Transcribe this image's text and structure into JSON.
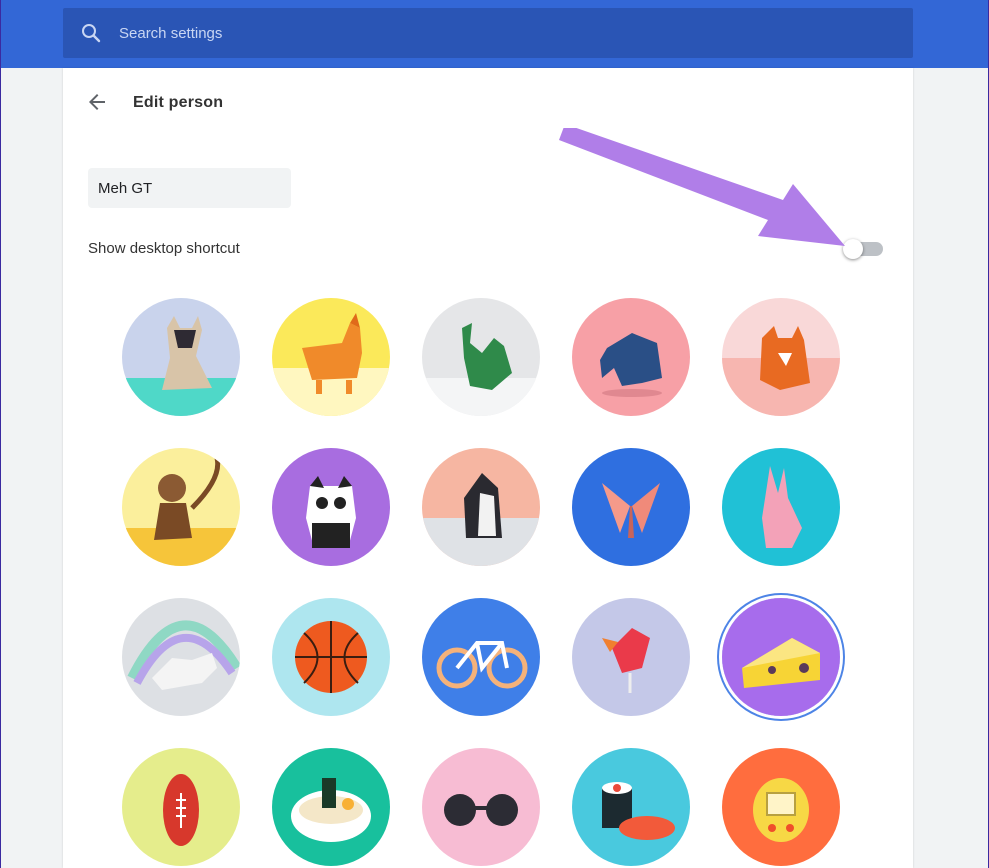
{
  "search": {
    "placeholder": "Search settings"
  },
  "header": {
    "title": "Edit person"
  },
  "form": {
    "name_value": "Meh GT",
    "shortcut_label": "Show desktop shortcut",
    "shortcut_enabled": false
  },
  "colors": {
    "topbar": "#3367d6",
    "searchbox": "#2a55b5",
    "annotation_arrow": "#b07ee8",
    "selection_ring": "#4d84e6"
  },
  "avatars": [
    {
      "name": "cat",
      "icon": "origami-cat-icon",
      "bg": "#c9d3ec",
      "selected": false
    },
    {
      "name": "corgi",
      "icon": "origami-corgi-icon",
      "bg": "#fbe95a",
      "selected": false
    },
    {
      "name": "dragon",
      "icon": "origami-dragon-icon",
      "bg": "#e5e6e8",
      "selected": false
    },
    {
      "name": "elephant",
      "icon": "origami-elephant-icon",
      "bg": "#f7a0a6",
      "selected": false
    },
    {
      "name": "fox",
      "icon": "origami-fox-icon",
      "bg": "#f9d8d8",
      "selected": false
    },
    {
      "name": "monkey",
      "icon": "origami-monkey-icon",
      "bg": "#fbef9c",
      "selected": false
    },
    {
      "name": "panda",
      "icon": "origami-panda-icon",
      "bg": "#a86de0",
      "selected": false
    },
    {
      "name": "penguin",
      "icon": "origami-penguin-icon",
      "bg": "#f6b6a2",
      "selected": false
    },
    {
      "name": "butterfly",
      "icon": "origami-butterfly-icon",
      "bg": "#2f6fe0",
      "selected": false
    },
    {
      "name": "rabbit",
      "icon": "origami-rabbit-icon",
      "bg": "#20c1d6",
      "selected": false
    },
    {
      "name": "unicorn",
      "icon": "origami-unicorn-icon",
      "bg": "#dde0e4",
      "selected": false
    },
    {
      "name": "basketball",
      "icon": "basketball-icon",
      "bg": "#aee6ef",
      "selected": false
    },
    {
      "name": "bicycle",
      "icon": "bicycle-icon",
      "bg": "#3f7fe8",
      "selected": false
    },
    {
      "name": "bird",
      "icon": "bird-icon",
      "bg": "#c4c8e8",
      "selected": false
    },
    {
      "name": "cheese",
      "icon": "cheese-icon",
      "bg": "#a76cec",
      "selected": true
    },
    {
      "name": "football",
      "icon": "football-icon",
      "bg": "#e5ed8c",
      "selected": false
    },
    {
      "name": "ramen",
      "icon": "ramen-icon",
      "bg": "#18c09d",
      "selected": false
    },
    {
      "name": "sunglasses",
      "icon": "sunglasses-icon",
      "bg": "#f7bcd3",
      "selected": false
    },
    {
      "name": "sushi",
      "icon": "sushi-icon",
      "bg": "#49c9de",
      "selected": false
    },
    {
      "name": "tamagotchi",
      "icon": "tamagotchi-icon",
      "bg": "#ff6d3e",
      "selected": false
    }
  ]
}
